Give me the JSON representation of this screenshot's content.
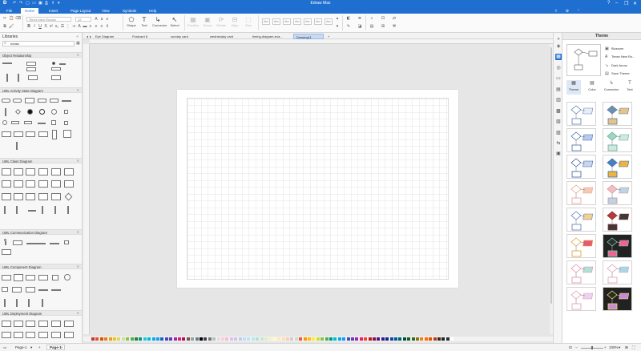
{
  "app": {
    "title": "Edraw Max"
  },
  "window_controls": [
    "?",
    "–",
    "❐",
    "✕"
  ],
  "menu": {
    "items": [
      "File",
      "Home",
      "Insert",
      "Page Layout",
      "View",
      "Symbols",
      "Help"
    ],
    "active": "Home"
  },
  "ribbon": {
    "font_name": "Times New Roman",
    "font_size": "12",
    "tools": {
      "shape": "Shape",
      "text": "Text",
      "connector": "Connector",
      "select": "Select"
    },
    "dim_tools": [
      "Position",
      "Group",
      "Rotate",
      "Align",
      "Size"
    ],
    "style_labels": [
      "Abc",
      "Abc",
      "Abc",
      "Abc",
      "Abc",
      "Abc",
      "Abc"
    ]
  },
  "libraries": {
    "title": "Libraries",
    "search_value": "edraw",
    "sections": [
      "Object Relationship",
      "UML Activity State Diagram",
      "UML Class Diagram",
      "UML Communication Diagram",
      "UML Component Diagram",
      "UML Deployment Diagram"
    ]
  },
  "tabs": [
    {
      "label": "Eye Diagram"
    },
    {
      "label": "Postcard 8"
    },
    {
      "label": "sunday card"
    },
    {
      "label": "wednesday card"
    },
    {
      "label": "timing-diagram-exa..."
    },
    {
      "label": "Drawing11"
    }
  ],
  "active_tab": "Drawing11",
  "status": {
    "page_selector": "Page-1",
    "page_name": "Page-1",
    "zoom": "100%"
  },
  "theme_panel": {
    "title": "Theme",
    "options": [
      {
        "icon": "blossom-icon",
        "label": "Blossom"
      },
      {
        "icon": "font-icon",
        "label": "Times New Ro..."
      },
      {
        "icon": "arrow-icon",
        "label": "Dark Arrow"
      },
      {
        "icon": "save-icon",
        "label": "Save Theme"
      }
    ],
    "tabs": [
      "Theme",
      "Color",
      "Connector",
      "Text"
    ]
  },
  "colors": {
    "accent": "#1f6fd1",
    "palette": [
      "#c0392b",
      "#e74c3c",
      "#d35400",
      "#e67e22",
      "#f39c12",
      "#f1c40f",
      "#e8d44d",
      "#c5e1a5",
      "#8bc34a",
      "#4caf50",
      "#2e7d32",
      "#009688",
      "#26c6da",
      "#00bcd4",
      "#03a9f4",
      "#2196f3",
      "#1565c0",
      "#3f51b5",
      "#673ab7",
      "#9c27b0",
      "#e91e63",
      "#ad1457",
      "#795548",
      "#9e9e9e",
      "#607d8b",
      "#000000",
      "#424242",
      "#757575",
      "#bdbdbd",
      "#e0e0e0",
      "#ffcdd2",
      "#f8bbd0",
      "#e1bee7",
      "#d1c4e9",
      "#c5cae9",
      "#bbdefb",
      "#b3e5fc",
      "#b2ebf2",
      "#b2dfdb",
      "#c8e6c9",
      "#dcedc8",
      "#f0f4c3",
      "#fff9c4",
      "#ffecb3",
      "#ffe0b2",
      "#ffccbc",
      "#d7ccc8",
      "#cfd8dc",
      "#ff5722",
      "#ff9800",
      "#ffc107",
      "#ffeb3b",
      "#cddc39",
      "#8bc34a",
      "#4caf50",
      "#009688",
      "#00bcd4",
      "#03a9f4",
      "#2196f3",
      "#3f51b5",
      "#673ab7",
      "#9c27b0",
      "#e91e63",
      "#f44336",
      "#b71c1c",
      "#880e4f",
      "#4a148c",
      "#311b92",
      "#1a237e",
      "#0d47a1",
      "#01579b",
      "#006064",
      "#004d40",
      "#1b5e20",
      "#33691e",
      "#827717",
      "#f57f17",
      "#ff6f00",
      "#e65100",
      "#bf360c",
      "#3e2723",
      "#212121",
      "#263238",
      "#ffffff"
    ]
  },
  "theme_cards": [
    {
      "shape": "#ffffff",
      "stroke": "#5b7bb5",
      "accent": "#e8eef8",
      "dark": false
    },
    {
      "shape": "#6d8fb0",
      "stroke": "#5f7c9a",
      "accent": "#e7c28b",
      "dark": false
    },
    {
      "shape": "#ffffff",
      "stroke": "#4a6aa8",
      "accent": "#b6c9ef",
      "dark": false
    },
    {
      "shape": "#9ed6c6",
      "stroke": "#64a796",
      "accent": "#cfe9df",
      "dark": false
    },
    {
      "shape": "#ffffff",
      "stroke": "#3a5ca0",
      "accent": "#c9d6ef",
      "dark": false
    },
    {
      "shape": "#4a7fc1",
      "stroke": "#3a6aa6",
      "accent": "#f0b43c",
      "dark": false
    },
    {
      "shape": "#ffffff",
      "stroke": "#e0a38e",
      "accent": "#f5c9b4",
      "dark": false
    },
    {
      "shape": "#f3bfc6",
      "stroke": "#d28e99",
      "accent": "#b9d6e6",
      "dark": false
    },
    {
      "shape": "#ffffff",
      "stroke": "#5a78b8",
      "accent": "#f5d08f",
      "dark": false
    },
    {
      "shape": "#b33b3b",
      "stroke": "#8e2f2f",
      "accent": "#3a3a3a",
      "dark": false
    },
    {
      "shape": "#ffffff",
      "stroke": "#e0a030",
      "accent": "#e85a74",
      "dark": false
    },
    {
      "shape": "#2e2e2e",
      "stroke": "#7ed1b8",
      "accent": "#f06292",
      "dark": true
    },
    {
      "shape": "#ffffff",
      "stroke": "#e08fb0",
      "accent": "#b0e0d6",
      "dark": false
    },
    {
      "shape": "#ffffff",
      "stroke": "#d9a0b8",
      "accent": "#a7d8e8",
      "dark": false
    },
    {
      "shape": "#ffffff",
      "stroke": "#e39aa8",
      "accent": "#e9d3f0",
      "dark": false
    },
    {
      "shape": "#2b2b2b",
      "stroke": "#f3e25a",
      "accent": "#c78ad8",
      "dark": true
    }
  ]
}
